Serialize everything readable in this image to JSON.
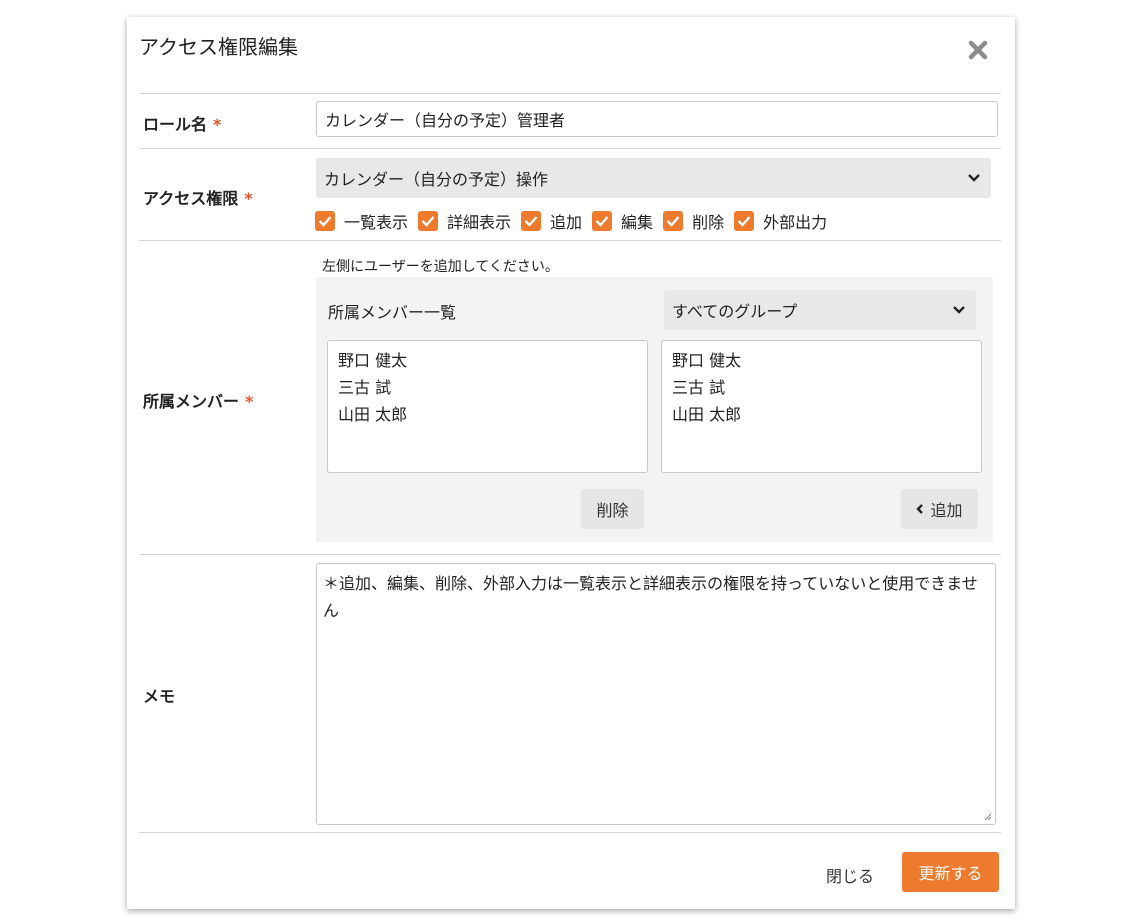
{
  "dialog": {
    "title": "アクセス権限編集",
    "close_icon": "close-x-icon"
  },
  "role": {
    "label": "ロール名",
    "required_mark": "*",
    "value": "カレンダー（自分の予定）管理者"
  },
  "access": {
    "label": "アクセス権限",
    "required_mark": "*",
    "selected": "カレンダー（自分の予定）操作",
    "checkboxes": [
      {
        "label": "一覧表示",
        "checked": true
      },
      {
        "label": "詳細表示",
        "checked": true
      },
      {
        "label": "追加",
        "checked": true
      },
      {
        "label": "編集",
        "checked": true
      },
      {
        "label": "削除",
        "checked": true
      },
      {
        "label": "外部出力",
        "checked": true
      }
    ]
  },
  "members": {
    "label": "所属メンバー",
    "required_mark": "*",
    "hint": "左側にユーザーを追加してください。",
    "list_title": "所属メンバー一覧",
    "group_select": "すべてのグループ",
    "left_list": [
      "野口 健太",
      "三古 試",
      "山田 太郎"
    ],
    "right_list": [
      "野口 健太",
      "三古 試",
      "山田 太郎"
    ],
    "remove_button": "削除",
    "add_button": "追加"
  },
  "memo": {
    "label": "メモ",
    "value": "＊追加、編集、削除、外部入力は一覧表示と詳細表示の権限を持っていないと使用できません"
  },
  "footer": {
    "close_label": "閉じる",
    "update_label": "更新する"
  },
  "colors": {
    "accent": "#ee7a2e",
    "required": "#e8532b"
  }
}
